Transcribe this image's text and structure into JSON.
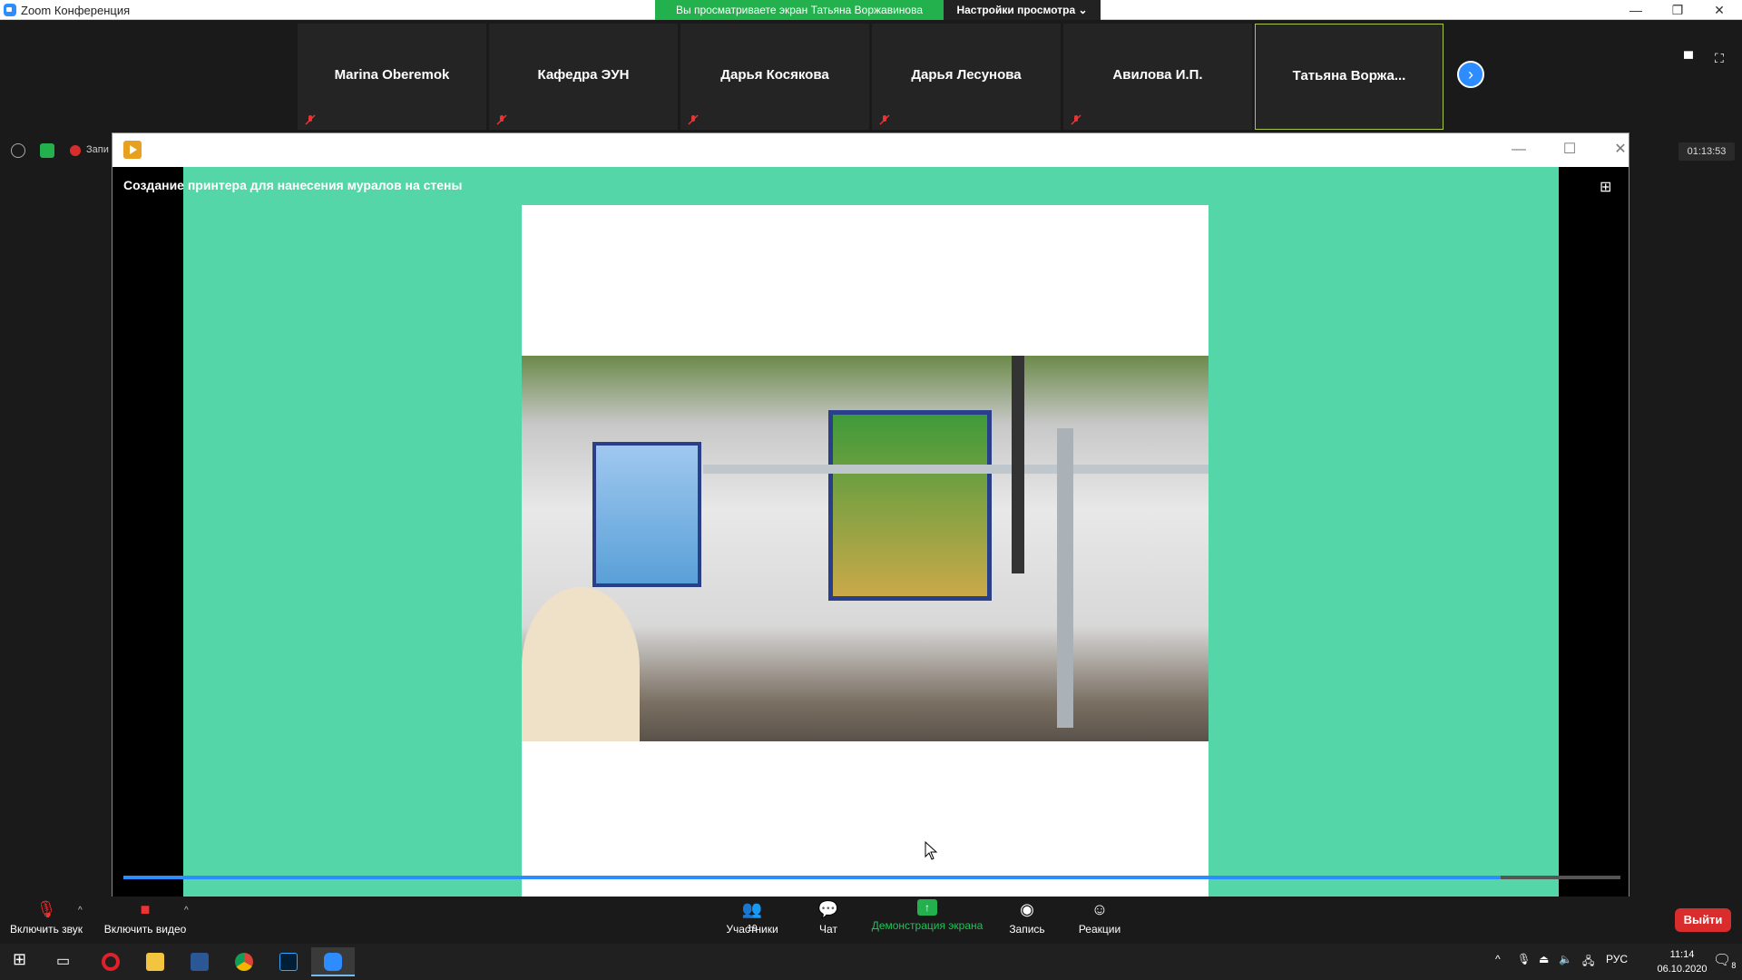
{
  "window": {
    "title": "Zoom Конференция",
    "minimize": "—",
    "restore": "❐",
    "close": "✕"
  },
  "banner": {
    "text": "Вы просматриваете экран Татьяна Воржавинова",
    "view_options": "Настройки просмотра ⌄"
  },
  "participants_strip": [
    {
      "name": "Marina Oberemok",
      "muted": true
    },
    {
      "name": "Кафедра ЭУН",
      "muted": true
    },
    {
      "name": "Дарья Косякова",
      "muted": true
    },
    {
      "name": "Дарья Лесунова",
      "muted": true
    },
    {
      "name": "Авилова И.П.",
      "muted": true
    },
    {
      "name": "Татьяна Воржа...",
      "muted": false,
      "active": true
    }
  ],
  "next_icon": "›",
  "status": {
    "recording_label": "Запи",
    "timer": "01:13:53"
  },
  "player": {
    "caption": "Создание принтера для нанесения муралов на стены",
    "progress": 0.92
  },
  "controls": {
    "audio": "Включить звук",
    "video": "Включить видео",
    "participants": "Участники",
    "participants_count": "19",
    "chat": "Чат",
    "share": "Демонстрация экрана",
    "record": "Запись",
    "reactions": "Реакции",
    "leave": "Выйти"
  },
  "taskbar": {
    "lang": "РУС",
    "time": "11:14",
    "date": "06.10.2020",
    "notifications": "8"
  },
  "colors": {
    "accent": "#2d8cff",
    "banner": "#22b14c",
    "slide_bg": "#55d6a8",
    "leave": "#d92d2d"
  }
}
